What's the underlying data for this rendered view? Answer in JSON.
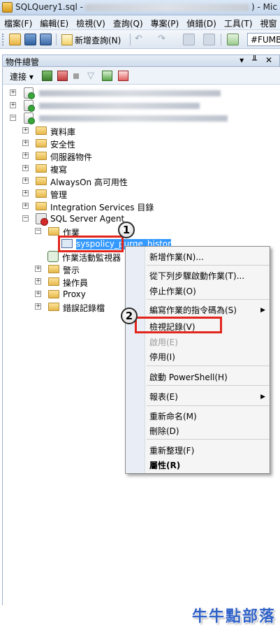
{
  "window": {
    "title_left": "SQLQuery1.sql -",
    "title_right": ") - Mic"
  },
  "menubar": [
    "檔案(F)",
    "編輯(E)",
    "檢視(V)",
    "查詢(Q)",
    "專案(P)",
    "偵錯(D)",
    "工具(T)",
    "視窗"
  ],
  "toolbar": {
    "new_query": "新增查詢(N)",
    "combo_value": "#FUMBT"
  },
  "panel": {
    "title": "物件總管",
    "buttons": "▾ ╨ ✕",
    "connect": "連接 ▾"
  },
  "tree": {
    "databases": "資料庫",
    "security": "安全性",
    "server_objects": "伺服器物件",
    "replication": "複寫",
    "alwayson": "AlwaysOn 高可用性",
    "management": "管理",
    "integration_services": "Integration Services 目錄",
    "sql_agent": "SQL Server Agent",
    "jobs": "作業",
    "selected_job": "syspolicy_purge_history",
    "job_monitor": "作業活動監視器",
    "alerts": "警示",
    "operators": "操作員",
    "proxy": "Proxy",
    "error_logs": "錯誤記錄檔"
  },
  "callouts": {
    "one": "1",
    "two": "2"
  },
  "context_menu": {
    "new_job": "新增作業(N)...",
    "start_at_step": "從下列步驟啟動作業(T)...",
    "stop_job": "停止作業(O)",
    "script_job_as": "編寫作業的指令碼為(S)",
    "view_history": "檢視記錄(V)",
    "enable": "啟用(E)",
    "disable": "停用(I)",
    "start_powershell": "啟動 PowerShell(H)",
    "reports": "報表(E)",
    "rename": "重新命名(M)",
    "delete": "刪除(D)",
    "refresh": "重新整理(F)",
    "properties": "屬性(R)"
  },
  "watermark": "牛牛點部落"
}
